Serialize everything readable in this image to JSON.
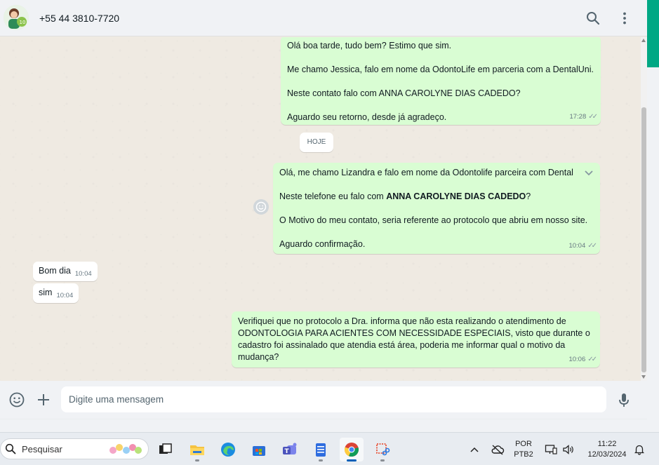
{
  "header": {
    "contact": "+55 44 3810-7720"
  },
  "messages": {
    "m1": {
      "lines": [
        "Olá boa tarde, tudo bem? Estimo que sim.",
        "Me chamo Jessica, falo em nome da OdontoLife em parceria com a DentalUni.",
        "Neste contato falo com ANNA CAROLYNE DIAS CADEDO?",
        "Aguardo seu retorno, desde já agradeço."
      ],
      "time": "17:28"
    },
    "date_divider": "HOJE",
    "m2": {
      "line1": "Olá, me chamo Lizandra e falo em nome da Odontolife parceira com Dental",
      "line2_pre": "Neste telefone eu falo com ",
      "line2_bold": "ANNA CAROLYNE DIAS CADEDO",
      "line2_post": "?",
      "line3": "O Motivo do meu contato, seria referente ao protocolo que abriu em nosso site.",
      "line4": "Aguardo confirmação.",
      "time": "10:04"
    },
    "m3": {
      "text": "Bom dia",
      "time": "10:04"
    },
    "m4": {
      "text": "sim",
      "time": "10:04"
    },
    "m5": {
      "text": "Verifiquei que no protocolo a Dra. informa que não esta realizando o atendimento de ODONTOLOGIA PARA ACIENTES COM NECESSIDADE ESPECIAIS, visto que durante o cadastro foi assinalado que atendia está área, poderia me informar qual o motivo da mudança?",
      "time": "10:06"
    }
  },
  "composer": {
    "placeholder": "Digite uma mensagem"
  },
  "taskbar": {
    "search_label": "Pesquisar",
    "lang_top": "POR",
    "lang_bottom": "PTB2",
    "time": "11:22",
    "date": "12/03/2024"
  },
  "colors": {
    "outgoing_bubble": "#d9fdd3",
    "incoming_bubble": "#ffffff",
    "accent": "#00a884",
    "chat_bg": "#efeae2"
  }
}
